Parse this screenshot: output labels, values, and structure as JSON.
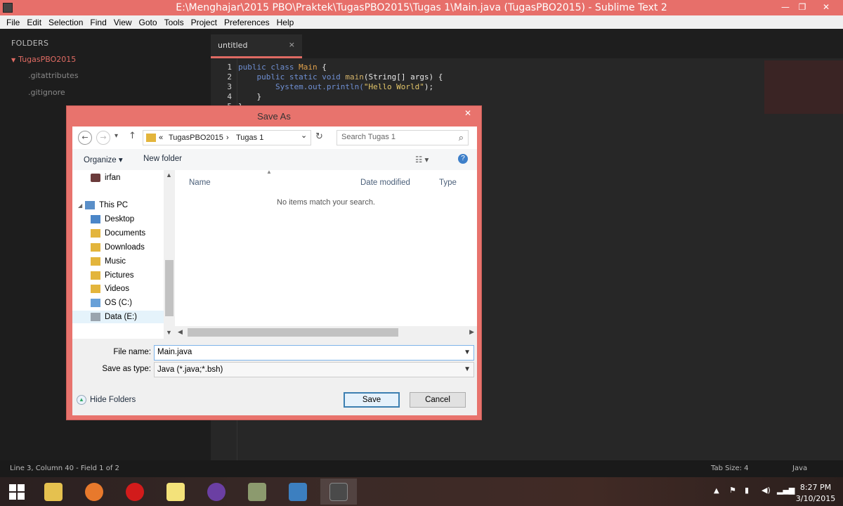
{
  "window": {
    "title": "E:\\Menghajar\\2015 PBO\\Praktek\\TugasPBO2015\\Tugas 1\\Main.java (TugasPBO2015) - Sublime Text 2",
    "minimize": "—",
    "maximize": "❐",
    "close": "✕"
  },
  "menu": [
    "File",
    "Edit",
    "Selection",
    "Find",
    "View",
    "Goto",
    "Tools",
    "Project",
    "Preferences",
    "Help"
  ],
  "sidebar": {
    "header": "FOLDERS",
    "folder": "TugasPBO2015",
    "files": [
      ".gitattributes",
      ".gitignore"
    ]
  },
  "editor": {
    "tab_label": "untitled",
    "tab_close": "×",
    "line_numbers": [
      "1",
      "2",
      "3",
      "4",
      "5"
    ],
    "code": {
      "l1_kw": "public class ",
      "l1_cls": "Main",
      "l1_rest": " {",
      "l2_indent": "    ",
      "l2_kw": "public static void ",
      "l2_fn": "main",
      "l2_rest": "(String[] args) {",
      "l3_indent": "        ",
      "l3_pre": "System.out.println(",
      "l3_str": "\"Hello World\"",
      "l3_post": ");",
      "l4": "    }",
      "l5": "}"
    }
  },
  "status": {
    "left": "Line 3, Column 40 - Field 1 of 2",
    "tab_size": "Tab Size: 4",
    "syntax": "Java"
  },
  "dialog": {
    "title": "Save As",
    "close": "✕",
    "back": "←",
    "forward": "→",
    "recent": "▾",
    "up": "↑",
    "breadcrumb": {
      "overflow": "«",
      "part1": "TugasPBO2015",
      "sep": "›",
      "part2": "Tugas 1",
      "dropdown": "⌄",
      "refresh": "↻"
    },
    "search_placeholder": "Search Tugas 1",
    "search_icon": "⌕",
    "organize": "Organize ▾",
    "new_folder": "New folder",
    "view_icon": "☷ ▾",
    "help_icon": "?",
    "nav_items": [
      {
        "label": "irfan"
      },
      {
        "label": "This PC"
      },
      {
        "label": "Desktop"
      },
      {
        "label": "Documents"
      },
      {
        "label": "Downloads"
      },
      {
        "label": "Music"
      },
      {
        "label": "Pictures"
      },
      {
        "label": "Videos"
      },
      {
        "label": "OS (C:)"
      },
      {
        "label": "Data (E:)"
      }
    ],
    "columns": [
      "Name",
      "Date modified",
      "Type"
    ],
    "empty_message": "No items match your search.",
    "file_name_label": "File name:",
    "file_name_value": "Main.java",
    "save_as_type_label": "Save as type:",
    "save_as_type_value": "Java (*.java;*.bsh)",
    "hide_folders": "Hide Folders",
    "save_button": "Save",
    "cancel_button": "Cancel"
  },
  "taskbar": {
    "clock_time": "8:27 PM",
    "clock_date": "3/10/2015"
  },
  "colors": {
    "accent": "#e76f6a",
    "editor_bg": "#272727",
    "sidebar_bg": "#1d1d1d"
  }
}
